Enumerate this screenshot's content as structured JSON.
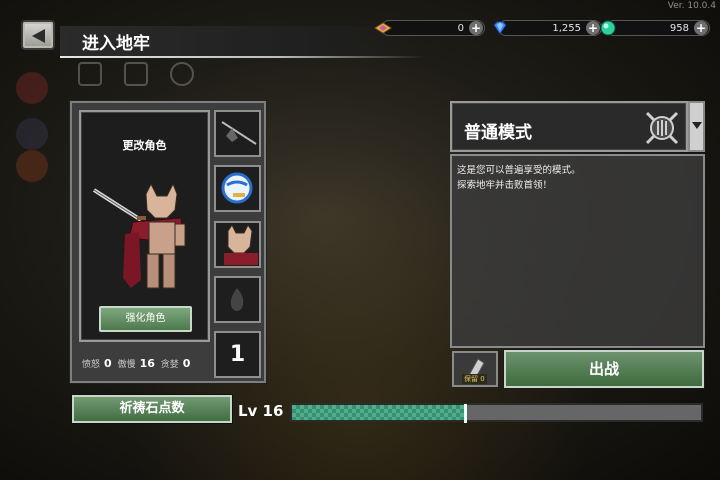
{
  "app": {
    "version": "Ver. 10.0.4"
  },
  "header": {
    "title": "进入地牢"
  },
  "currencies": [
    {
      "icon": "gold-gem-icon",
      "value": "0",
      "color": "#e0b04a"
    },
    {
      "icon": "blue-diamond-icon",
      "value": "1,255",
      "color": "#3a8cff"
    },
    {
      "icon": "green-orb-icon",
      "value": "958",
      "color": "#2fd0a0"
    }
  ],
  "character": {
    "change_label": "更改角色",
    "upgrade_label": "强化角色",
    "slot_count_value": "1",
    "stats": [
      {
        "label": "愤怒",
        "value": "0"
      },
      {
        "label": "傲慢",
        "value": "16"
      },
      {
        "label": "贪婪",
        "value": "0"
      }
    ]
  },
  "mode": {
    "title": "普通模式",
    "desc_line1": "这是您可以普遍享受的模式。",
    "desc_line2": "探索地牢并击败首领！",
    "keep_label": "保留 0",
    "start_label": "出战"
  },
  "footer": {
    "prayer_label": "祈祷石点数",
    "level_label": "Lv 16",
    "xp_progress": 0.425
  }
}
